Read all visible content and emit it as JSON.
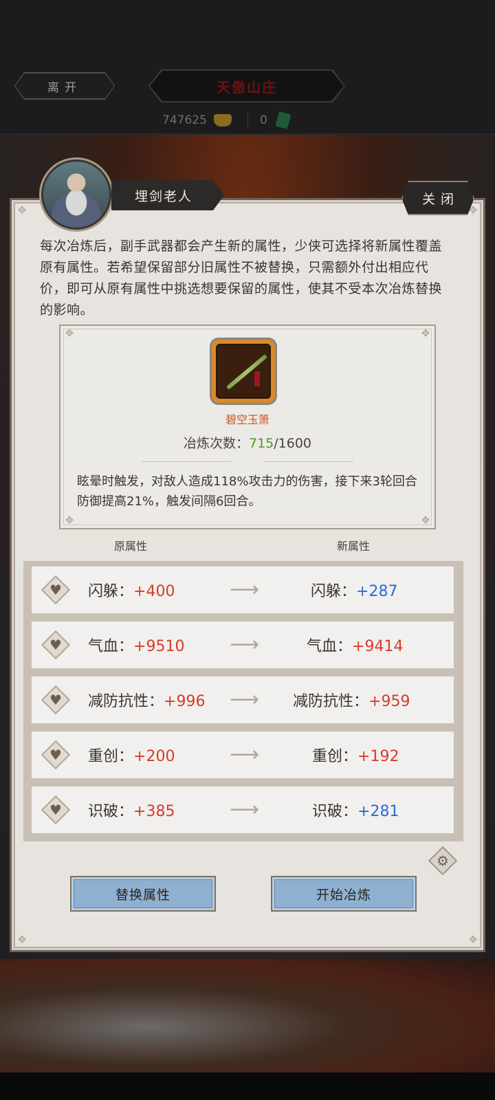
{
  "topbar": {
    "leave_label": "离开",
    "location": "天傲山庄",
    "gold": "747625",
    "cash": "0"
  },
  "dialog": {
    "npc_name": "埋剑老人",
    "close_label": "关闭",
    "description": "每次冶炼后，副手武器都会产生新的属性，少侠可选择将新属性覆盖原有属性。若希望保留部分旧属性不被替换，只需额外付出相应代价，即可从原有属性中挑选想要保留的属性，使其不受本次冶炼替换的影响。",
    "item": {
      "name": "碧空玉箫",
      "refine_label": "冶炼次数：",
      "refine_current": "715",
      "refine_total": "/1600",
      "effect": "眩晕时触发，对敌人造成118%攻击力的伤害，接下来3轮回合防御提高21%，触发间隔6回合。"
    },
    "col_old": "原属性",
    "col_new": "新属性",
    "attributes": [
      {
        "name": "闪躲：",
        "old": "+400",
        "new": "+287",
        "new_color": "blue"
      },
      {
        "name": "气血：",
        "old": "+9510",
        "new": "+9414",
        "new_color": "red"
      },
      {
        "name": "减防抗性：",
        "old": "+996",
        "new": "+959",
        "new_color": "red"
      },
      {
        "name": "重创：",
        "old": "+200",
        "new": "+192",
        "new_color": "red"
      },
      {
        "name": "识破：",
        "old": "+385",
        "new": "+281",
        "new_color": "blue"
      }
    ],
    "replace_button": "替换属性",
    "start_button": "开始冶炼"
  },
  "icons": {
    "gold": "gold-ingot-icon",
    "cash": "cash-icon",
    "attribute": "heart-icon",
    "arrow": "arrow-right-icon",
    "settings": "gear-icon"
  },
  "colors": {
    "increase_red": "#d83a2a",
    "decrease_blue": "#2a6ad8",
    "refine_green": "#4a9a2a",
    "item_orange": "#d2581f",
    "button_blue": "#8fb0d0"
  }
}
